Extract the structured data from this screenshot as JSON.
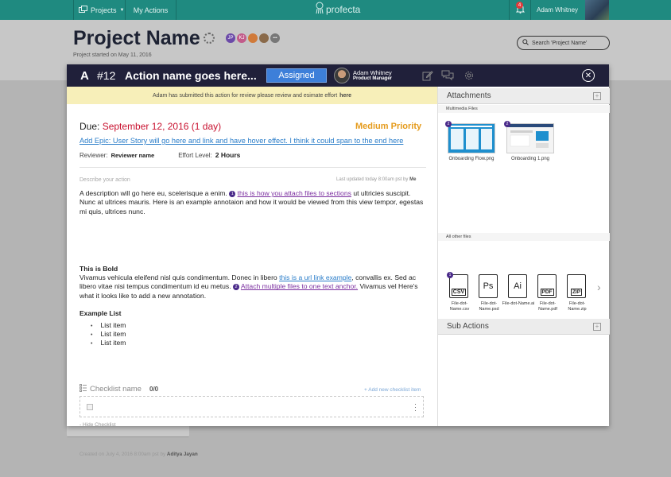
{
  "topnav": {
    "projects_label": "Projects",
    "my_actions_label": "My Actions",
    "logo_text": "profecta",
    "notification_count": "4",
    "user_name": "Adam Whitney",
    "brand_color": "#1f8a80"
  },
  "project": {
    "title": "Project Name",
    "started": "Project started on May 11, 2016",
    "search_placeholder": "Search 'Project Name'",
    "people": [
      {
        "initials": "JP",
        "color": "#6b4aa8"
      },
      {
        "initials": "KJ",
        "color": "#c25b8a"
      },
      {
        "initials": "",
        "color": "#d07a3a"
      },
      {
        "initials": "",
        "color": "#8a6a4a"
      }
    ],
    "more_label": "•••"
  },
  "modal": {
    "logo": "A",
    "number": "#12",
    "title": "Action name goes here...",
    "status": "Assigned",
    "assignee_name": "Adam Whitney",
    "assignee_role": "Product Manager",
    "header_color": "#20203a",
    "notice_text": "Adam has submitted this action for review please review and esimate effort",
    "notice_link": "here",
    "due_label": "Due:",
    "due_value": "September 12, 2016 (1 day)",
    "priority": "Medium Priority",
    "epic_link": "Add Epic: User Story will go here and link and have hover effect. I think it could span to the end here",
    "reviewer_label": "Reviewer:",
    "reviewer_value": "Reviewer name",
    "effort_label": "Effort Level:",
    "effort_value": "2 Hours",
    "describe_label": "Describe your action",
    "updated_text": "Last updated today 8:00am pst by",
    "updated_by": "Me",
    "p1": {
      "a": "A description will go here eu, scelerisque a enim.",
      "badge1": "1",
      "link1": "this is how you attach files to sections",
      "b": "ut ultricies suscipit. Nunc at ultrices mauris. Here is an example annotaion and how it would be viewed from this view tempor, egestas mi quis, ultrices nunc."
    },
    "bold_heading": "This is Bold",
    "p2": {
      "a": "Vivamus vehicula eleifend nisl quis condimentum. Donec in libero",
      "link_url": "this is a url link example",
      "b": ", convallis ex. Sed ac libero vitae nisi tempus condimentum id eu metus.",
      "badge2": "2",
      "link2": "Attach multiple files to one text anchor.",
      "c": "Vivamus vel Here's what it looks like to add a new annotation."
    },
    "example_list_heading": "Example List",
    "list_items": [
      "List item",
      "List item",
      "List item"
    ],
    "checklist_name": "Checklist name",
    "checklist_count": "0/0",
    "add_checklist_item": "+ Add new checklist item",
    "hide_checklist": "- Hide Checklist",
    "created_text": "Created on July 4, 2016 8:00am pst by",
    "created_by": "Aditya Jayan"
  },
  "attachments": {
    "title": "Attachments",
    "multimedia_label": "Multimedia Files",
    "thumbs": [
      {
        "name": "Onboarding Flow.png",
        "badge": "2"
      },
      {
        "name": "Onboarding 1.png",
        "badge": "2"
      }
    ],
    "other_label": "All other files",
    "files": [
      {
        "type": "CSV",
        "name": "File-dot-Name.csv",
        "badge": "1"
      },
      {
        "type": "Ps",
        "name": "File-dot-Name.psd"
      },
      {
        "type": "Ai",
        "name": "File-dot-Name.ai"
      },
      {
        "type": "PDF",
        "name": "File-dot-Name.pdf"
      },
      {
        "type": "ZIP",
        "name": "File-dot-Name.zip"
      }
    ],
    "add_symbol": "+",
    "next_symbol": "›"
  },
  "sub_actions": {
    "title": "Sub Actions",
    "add_symbol": "+"
  }
}
